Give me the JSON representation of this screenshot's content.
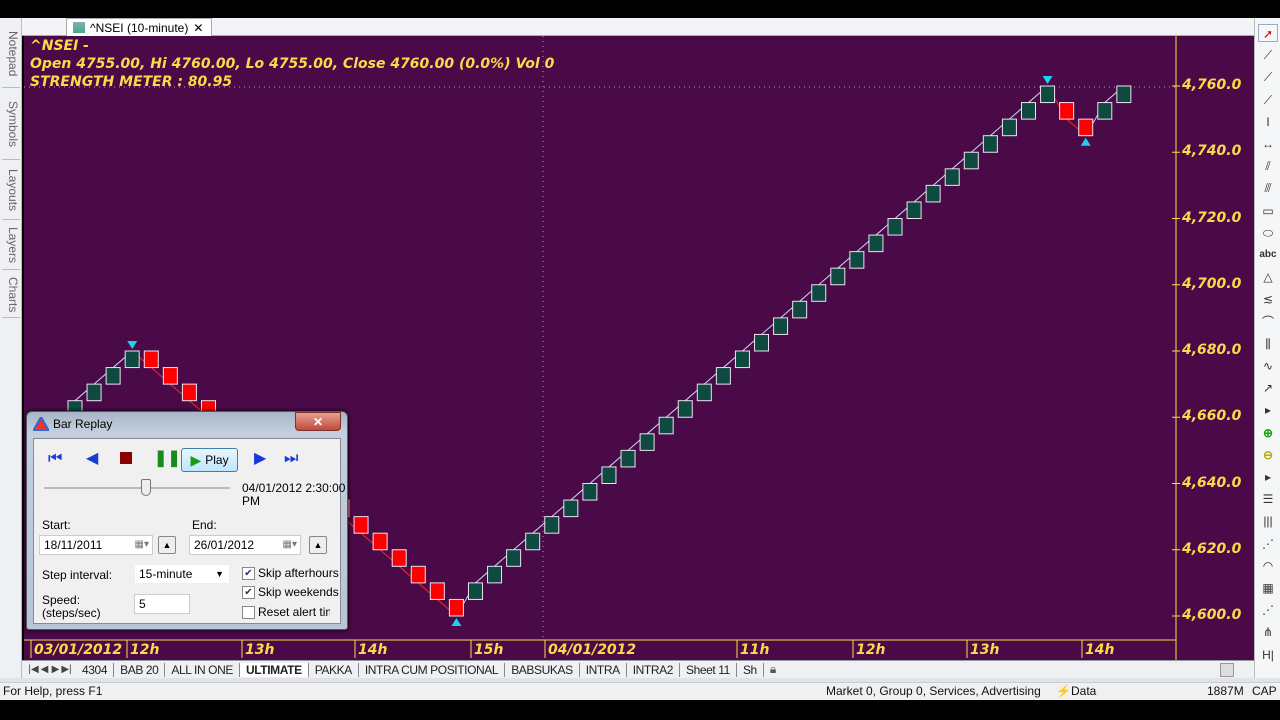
{
  "left_tabs": [
    "Notepad",
    "Symbols",
    "Layouts",
    "Layers",
    "Charts"
  ],
  "doc_tab": {
    "title": "^NSEI (10-minute)",
    "close": "✕"
  },
  "chart": {
    "info_line1": "^NSEI -",
    "info_line2": "Open 4755.00, Hi 4760.00, Lo 4755.00, Close 4760.00 (0.0%) Vol 0",
    "info_line3": "STRENGTH METER : 80.95",
    "background": "#4a0a47",
    "up_color": "#0f4a40",
    "down_color": "#ff0000",
    "text_color": "#ffd84a"
  },
  "chart_data": {
    "type": "renko",
    "box_size": 5,
    "ylim": [
      4595,
      4775
    ],
    "y_ticks": [
      "4,600.0",
      "4,620.0",
      "4,640.0",
      "4,660.0",
      "4,680.0",
      "4,700.0",
      "4,720.0",
      "4,740.0",
      "4,760.0"
    ],
    "y_tick_values": [
      4600,
      4620,
      4640,
      4660,
      4680,
      4700,
      4720,
      4740,
      4760
    ],
    "x_ticks": [
      "03/01/2012",
      "12h",
      "13h",
      "14h",
      "15h",
      "04/01/2012",
      "11h",
      "12h",
      "13h",
      "14h"
    ],
    "bricks": [
      [
        4660,
        4665
      ],
      [
        4665,
        4670
      ],
      [
        4670,
        4675
      ],
      [
        4675,
        4680
      ],
      [
        4680,
        4675
      ],
      [
        4675,
        4670
      ],
      [
        4670,
        4665
      ],
      [
        4665,
        4660
      ],
      [
        4660,
        4655
      ],
      [
        4655,
        4650
      ],
      [
        4650,
        4645
      ],
      [
        4645,
        4640
      ],
      [
        4640,
        4635
      ],
      [
        4635,
        4640
      ],
      [
        4635,
        4630
      ],
      [
        4630,
        4625
      ],
      [
        4625,
        4620
      ],
      [
        4620,
        4615
      ],
      [
        4615,
        4610
      ],
      [
        4610,
        4605
      ],
      [
        4605,
        4600
      ],
      [
        4605,
        4610
      ],
      [
        4610,
        4615
      ],
      [
        4615,
        4620
      ],
      [
        4620,
        4625
      ],
      [
        4625,
        4630
      ],
      [
        4630,
        4635
      ],
      [
        4635,
        4640
      ],
      [
        4640,
        4645
      ],
      [
        4645,
        4650
      ],
      [
        4650,
        4655
      ],
      [
        4655,
        4660
      ],
      [
        4660,
        4665
      ],
      [
        4665,
        4670
      ],
      [
        4670,
        4675
      ],
      [
        4675,
        4680
      ],
      [
        4680,
        4685
      ],
      [
        4685,
        4690
      ],
      [
        4690,
        4695
      ],
      [
        4695,
        4700
      ],
      [
        4700,
        4705
      ],
      [
        4705,
        4710
      ],
      [
        4710,
        4715
      ],
      [
        4715,
        4720
      ],
      [
        4720,
        4725
      ],
      [
        4725,
        4730
      ],
      [
        4730,
        4735
      ],
      [
        4735,
        4740
      ],
      [
        4740,
        4745
      ],
      [
        4745,
        4750
      ],
      [
        4750,
        4755
      ],
      [
        4755,
        4760
      ],
      [
        4755,
        4750
      ],
      [
        4750,
        4745
      ],
      [
        4750,
        4755
      ],
      [
        4755,
        4760
      ]
    ],
    "signals": [
      {
        "brick": 3,
        "type": "sell"
      },
      {
        "brick": 13,
        "type": "sell"
      },
      {
        "brick": 20,
        "type": "buy"
      },
      {
        "brick": 51,
        "type": "sell"
      },
      {
        "brick": 53,
        "type": "buy"
      }
    ]
  },
  "right_toolbar": [
    "cursor-icon",
    "line-icon",
    "ray-icon",
    "extended-line-icon",
    "vertical-segment-icon",
    "horizontal-segment-icon",
    "parallel-lines-icon",
    "channel-icon",
    "rectangle-icon",
    "ellipse-icon",
    "text-icon",
    "triangle-icon",
    "fibonacci-icon",
    "arc-icon",
    "cycle-lines-icon",
    "zigzag-icon",
    "arrow-icon",
    "more-icon",
    "zoom-in-icon",
    "zoom-out-icon",
    "more-icon",
    "horizontal-lines-icon",
    "vertical-lines-icon",
    "fan-icon",
    "arcs-icon",
    "grid-icon",
    "gann-fan-icon",
    "pitchfork-icon",
    "timezones-icon"
  ],
  "dialog": {
    "title": "Bar Replay",
    "close": "✕",
    "play_label": "Play",
    "position_fraction": 0.55,
    "current_time_line1": "04/01/2012 2:30:00",
    "current_time_line2": "PM",
    "start_label": "Start:",
    "start_value": "18/11/2011",
    "end_label": "End:",
    "end_value": "26/01/2012",
    "step_label": "Step interval:",
    "step_value": "15-minute",
    "speed_label1": "Speed:",
    "speed_label2": "(steps/sec)",
    "speed_value": "5",
    "skip_afterhours": {
      "label": "Skip afterhours",
      "checked": true
    },
    "skip_weekends": {
      "label": "Skip weekends",
      "checked": true
    },
    "reset_alert": {
      "label": "Reset alert time",
      "checked": false
    }
  },
  "sheets": [
    "4304",
    "BAB 20",
    "ALL IN ONE",
    "ULTIMATE",
    "PAKKA",
    "INTRA CUM POSITIONAL",
    "BABSUKAS",
    "INTRA",
    "INTRA2",
    "Sheet 11",
    "Sh"
  ],
  "active_sheet": "ULTIMATE",
  "status": {
    "help": "For Help, press F1",
    "market": "Market 0, Group 0, Services, Advertising",
    "data": "Data",
    "memory": "1887M",
    "caps": "CAP"
  }
}
